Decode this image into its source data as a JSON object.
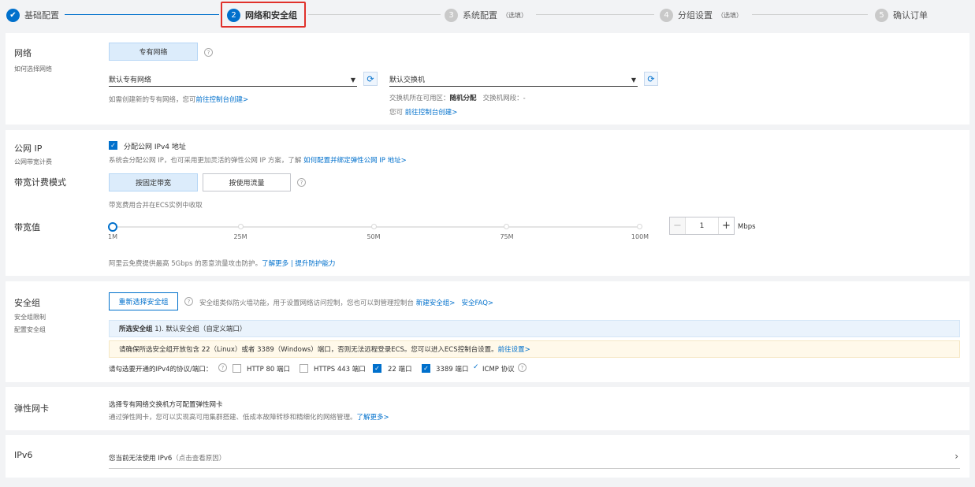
{
  "steps": [
    {
      "num": "✔",
      "label": "基础配置",
      "optional": ""
    },
    {
      "num": "2",
      "label": "网络和安全组",
      "optional": ""
    },
    {
      "num": "3",
      "label": "系统配置",
      "optional": "（选填）"
    },
    {
      "num": "4",
      "label": "分组设置",
      "optional": "（选填）"
    },
    {
      "num": "5",
      "label": "确认订单",
      "optional": ""
    }
  ],
  "network": {
    "title": "网络",
    "subtitle": "如何选择网络",
    "type_button": "专有网络",
    "vpc_select": "默认专有网络",
    "vswitch_select": "默认交换机",
    "vpc_hint": "如需创建新的专有网络，您可",
    "vpc_link": "前往控制台创建>",
    "zone_label": "交换机所在可用区：",
    "zone_value": "随机分配",
    "cidr_label": "交换机网段：",
    "cidr_value": "-",
    "vswitch_hint": "您可",
    "vswitch_link": "前往控制台创建>"
  },
  "public_ip": {
    "title": "公网 IP",
    "subtitle": "公网带宽计费",
    "checkbox_label": "分配公网 IPv4 地址",
    "hint": "系统会分配公网 IP，也可采用更加灵活的弹性公网 IP 方案，了解",
    "hint_link": "如何配置并绑定弹性公网 IP 地址>",
    "billing_title": "带宽计费模式",
    "billing_fixed": "按固定带宽",
    "billing_traffic": "按使用流量",
    "billing_hint": "带宽费用合并在ECS实例中收取",
    "bandwidth_title": "带宽值",
    "ticks": [
      "1M",
      "25M",
      "50M",
      "75M",
      "100M"
    ],
    "bandwidth_value": "1",
    "unit": "Mbps",
    "slider_fraction": 0,
    "ddos_text": "阿里云免费提供最高 5Gbps 的恶意流量攻击防护。",
    "ddos_link1": "了解更多",
    "ddos_sep": "|",
    "ddos_link2": "提升防护能力"
  },
  "security_group": {
    "title": "安全组",
    "sub1": "安全组限制",
    "sub2": "配置安全组",
    "reselect_button": "重新选择安全组",
    "desc": "安全组类似防火墙功能，用于设置网络访问控制，您也可以到管理控制台",
    "new_link": "新建安全组>",
    "faq_link": "安全FAQ>",
    "selected_label": "所选安全组",
    "selected_value": "1). 默认安全组（自定义端口）",
    "warning": "请确保所选安全组开放包含 22（Linux）或者 3389（Windows）端口，否则无法远程登录ECS。您可以进入ECS控制台设置。",
    "warning_link": "前往设置>",
    "ports_label": "请勾选要开通的IPv4的协议/端口：",
    "ports": [
      {
        "label": "HTTP 80 端口",
        "checked": false
      },
      {
        "label": "HTTPS 443 端口",
        "checked": false
      },
      {
        "label": "22 端口",
        "checked": true
      },
      {
        "label": "3389 端口",
        "checked": true
      }
    ],
    "icmp_label": "ICMP 协议"
  },
  "eni": {
    "title": "弹性网卡",
    "line1": "选择专有网络交换机方可配置弹性网卡",
    "line2": "通过弹性网卡，您可以实现高可用集群搭建、低成本故障转移和精细化的网络管理。",
    "link": "了解更多>"
  },
  "ipv6": {
    "title": "IPv6",
    "text": "您当前无法使用 IPv6",
    "reason": "（点击查看原因）",
    "chevron": "›"
  },
  "colors": {
    "accent": "#0070cc",
    "highlight_box": "#e0312b"
  }
}
